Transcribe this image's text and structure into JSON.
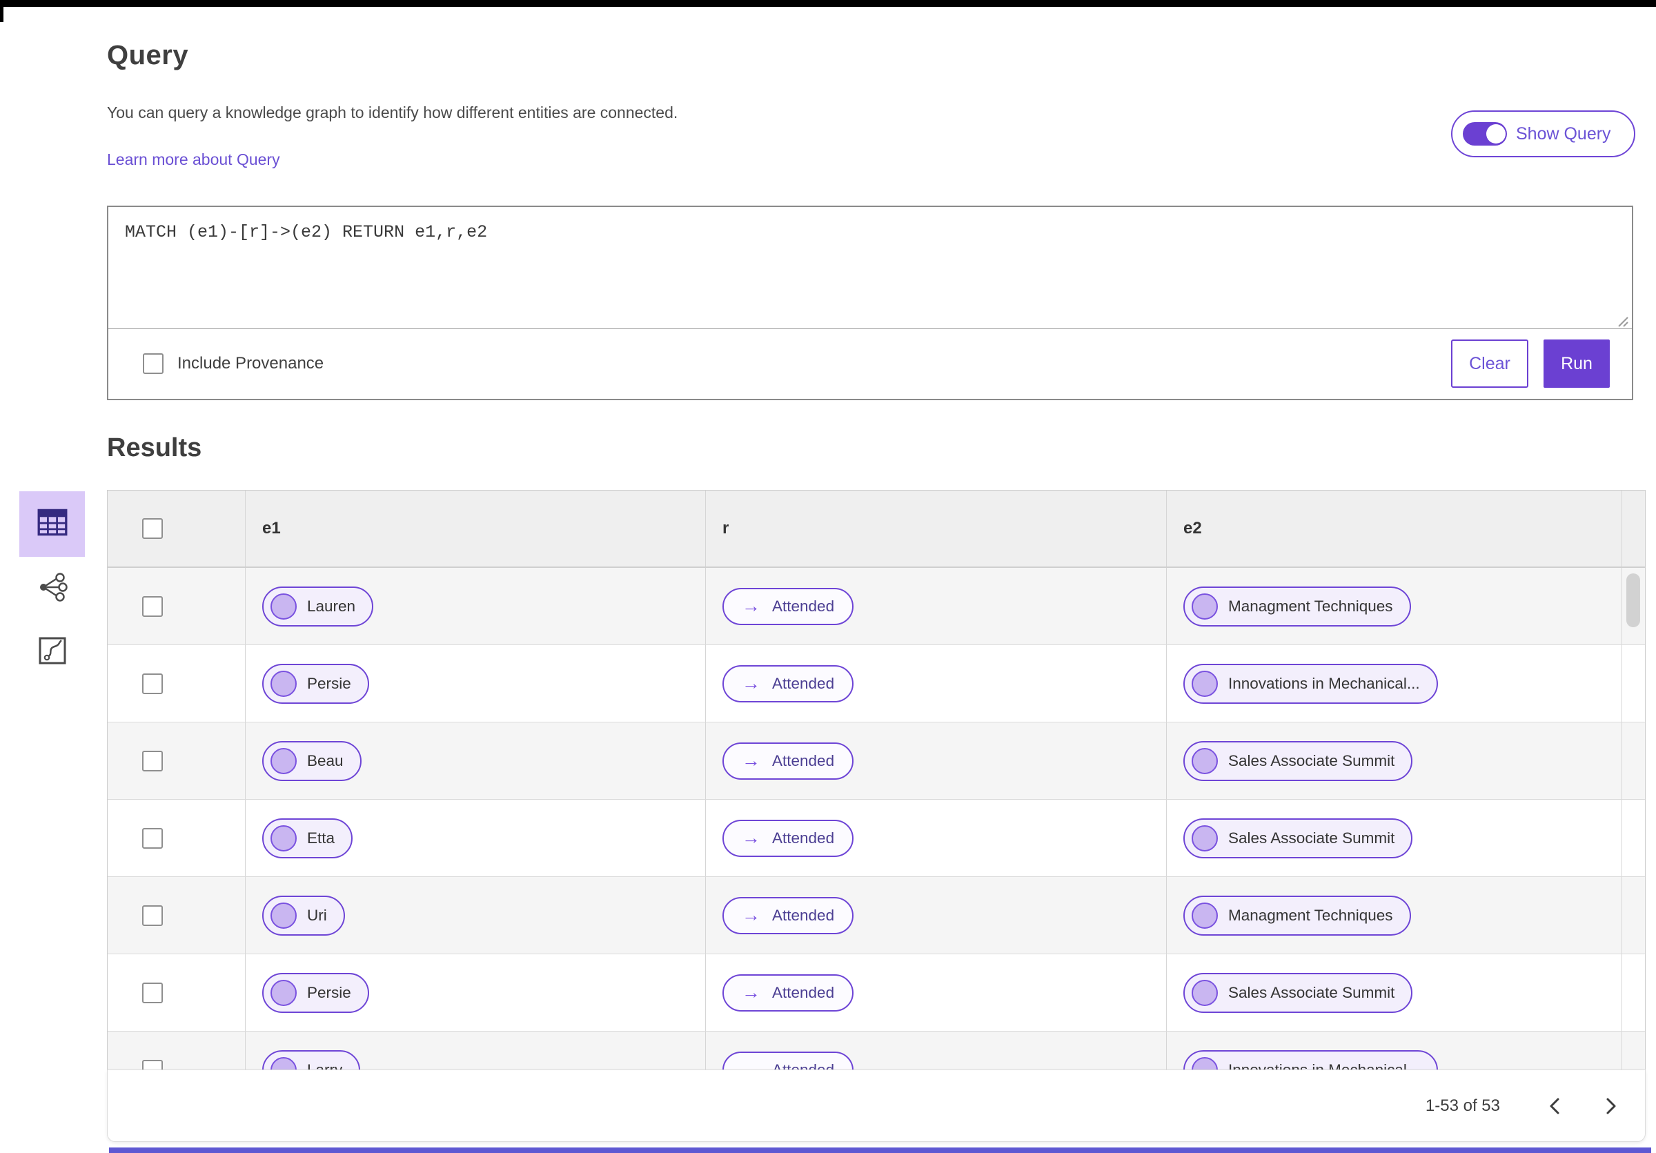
{
  "header": {
    "title": "Query",
    "description": "You can query a knowledge graph to identify how different entities are connected.",
    "learn_more_label": "Learn more about Query",
    "show_query_label": "Show Query",
    "show_query_toggle_on": true
  },
  "query_panel": {
    "query_text": "MATCH (e1)-[r]->(e2) RETURN e1,r,e2",
    "include_provenance_label": "Include Provenance",
    "include_provenance_checked": false,
    "clear_label": "Clear",
    "run_label": "Run"
  },
  "results": {
    "title": "Results",
    "view_switcher": [
      {
        "name": "table-view",
        "selected": true
      },
      {
        "name": "graph-view",
        "selected": false
      },
      {
        "name": "path-view",
        "selected": false
      }
    ],
    "table": {
      "columns": [
        "e1",
        "r",
        "e2"
      ],
      "rows": [
        {
          "e1": "Lauren",
          "r": "Attended",
          "e2": "Managment Techniques"
        },
        {
          "e1": "Persie",
          "r": "Attended",
          "e2": "Innovations in Mechanical..."
        },
        {
          "e1": "Beau",
          "r": "Attended",
          "e2": "Sales Associate Summit"
        },
        {
          "e1": "Etta",
          "r": "Attended",
          "e2": "Sales Associate Summit"
        },
        {
          "e1": "Uri",
          "r": "Attended",
          "e2": "Managment Techniques"
        },
        {
          "e1": "Persie",
          "r": "Attended",
          "e2": "Sales Associate Summit"
        },
        {
          "e1": "Larry",
          "r": "Attended",
          "e2": "Innovations in Mechanical..."
        }
      ]
    },
    "pagination": {
      "range_label": "1-53 of 53"
    }
  },
  "icons": {
    "arrow_right": "→"
  },
  "colors": {
    "accent_purple": "#6b40d2",
    "pill_border": "#6e45d6",
    "selected_tile_bg": "#dac9f8",
    "header_row_bg": "#efefef",
    "alt_row_bg": "#f5f5f5",
    "bottom_strip": "#5e58d2"
  }
}
